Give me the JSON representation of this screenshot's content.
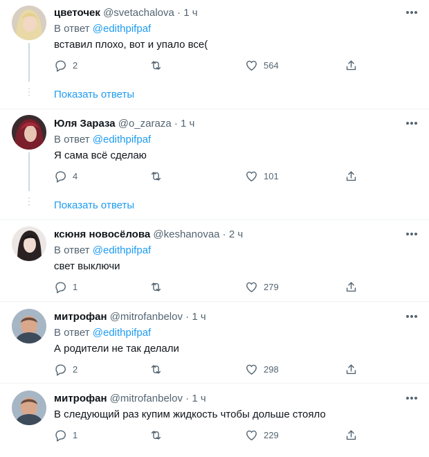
{
  "tweets": [
    {
      "name": "цветочек",
      "handle": "@svetachalova",
      "dot": "·",
      "time": "1 ч",
      "reply_prefix": "В ответ",
      "reply_mention": "@edithpifpaf",
      "text": "вставил плохо, вот и упало все(",
      "replies": "2",
      "retweets": "",
      "likes": "564",
      "show_replies": "Показать ответы"
    },
    {
      "name": "Юля Зараза",
      "handle": "@o_zaraza",
      "dot": "·",
      "time": "1 ч",
      "reply_prefix": "В ответ",
      "reply_mention": "@edithpifpaf",
      "text": "Я сама всё сделаю",
      "replies": "4",
      "retweets": "",
      "likes": "101",
      "show_replies": "Показать ответы"
    },
    {
      "name": "ксюня новосёлова",
      "handle": "@keshanovaa",
      "dot": "·",
      "time": "2 ч",
      "reply_prefix": "В ответ",
      "reply_mention": "@edithpifpaf",
      "text": "свет выключи",
      "replies": "1",
      "retweets": "",
      "likes": "279"
    },
    {
      "name": "митрофан",
      "handle": "@mitrofanbelov",
      "dot": "·",
      "time": "1 ч",
      "reply_prefix": "В ответ",
      "reply_mention": "@edithpifpaf",
      "text": "А родители не так делали",
      "replies": "2",
      "retweets": "",
      "likes": "298"
    },
    {
      "name": "митрофан",
      "handle": "@mitrofanbelov",
      "dot": "·",
      "time": "1 ч",
      "text": "В следующий раз купим жидкость чтобы дольше стояло",
      "replies": "1",
      "retweets": "",
      "likes": "229"
    }
  ],
  "colors": {
    "accent": "#1d9bf0",
    "secondary_text": "#536471",
    "primary_text": "#0f1419",
    "divider": "#eff3f4"
  },
  "icons": [
    "more-icon",
    "reply-icon",
    "retweet-icon",
    "like-icon",
    "share-icon"
  ]
}
